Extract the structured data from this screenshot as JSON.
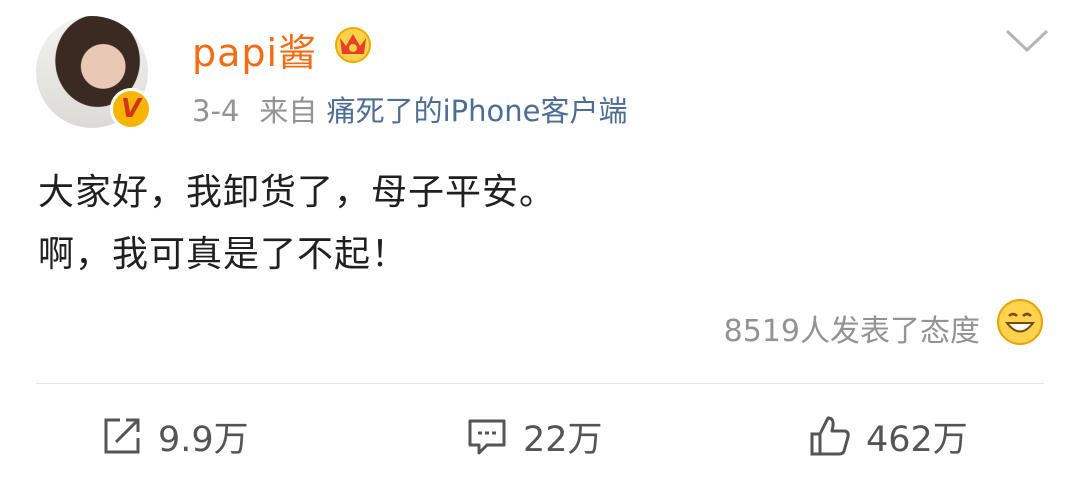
{
  "user": {
    "name": "papi酱",
    "verified_mark": "V"
  },
  "meta": {
    "date": "3-4",
    "from_label": "来自",
    "source": "痛死了的iPhone客户端"
  },
  "post": {
    "lines": [
      "大家好，我卸货了，母子平安。",
      "啊，我可真是了不起！"
    ]
  },
  "reactions": {
    "text": "8519人发表了态度"
  },
  "actions": {
    "repost_count": "9.9万",
    "comment_count": "22万",
    "like_count": "462万"
  },
  "colors": {
    "username": "#f56b12",
    "source_link": "#4c6d97",
    "meta_gray": "#939393",
    "badge": "#f7b500"
  },
  "icons": [
    "crown-icon",
    "chevron-down-icon",
    "smile-emoji-icon",
    "repost-icon",
    "comment-icon",
    "thumbs-up-icon"
  ]
}
